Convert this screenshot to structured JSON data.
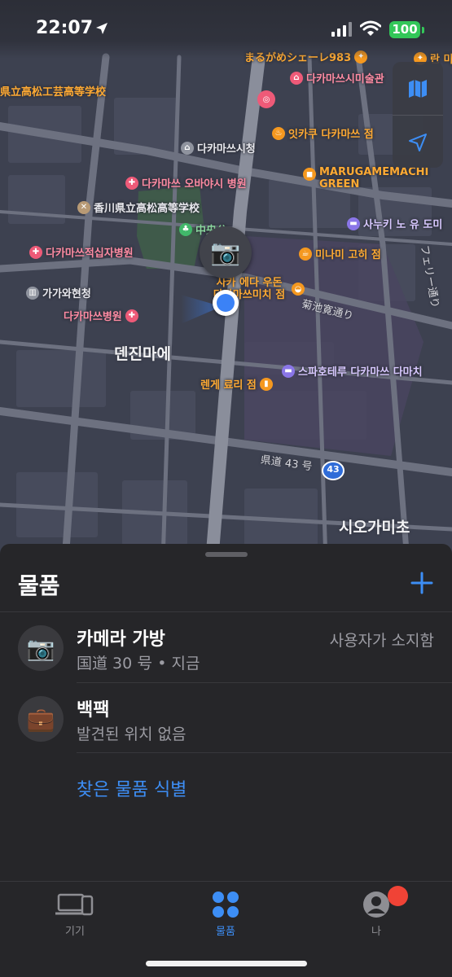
{
  "status_bar": {
    "time": "22:07",
    "battery": "100"
  },
  "map": {
    "pois": [
      {
        "id": "marugame-top",
        "label": "まるがめシェーレ983"
      },
      {
        "id": "museum",
        "label": "다카마쓰시미술관"
      },
      {
        "id": "school-left",
        "label": "県立高松工芸高等学校"
      },
      {
        "id": "city-hall",
        "label": "다카마쓰시청"
      },
      {
        "id": "restaurant-ikkaku",
        "label": "잇카쿠 다카마쓰 점"
      },
      {
        "id": "hospital-ohbayashi",
        "label": "다카마쓰 오바야시 병원"
      },
      {
        "id": "marugame-green",
        "label": "MARUGAMEMACHI GREEN"
      },
      {
        "id": "high-school",
        "label": "香川県立高松高等学校"
      },
      {
        "id": "park",
        "label": "中央公"
      },
      {
        "id": "sanuki-hotel",
        "label": "사누키 노 유 도미"
      },
      {
        "id": "red-cross",
        "label": "다카마쓰적십자병원"
      },
      {
        "id": "minami-tea",
        "label": "미나미 고히 점"
      },
      {
        "id": "kagawa-hall",
        "label": "가가와현청"
      },
      {
        "id": "udon",
        "label": "사카 에다 우돈 다카마쓰미치 점"
      },
      {
        "id": "takamatsu-hospital",
        "label": "다카마쓰병원"
      },
      {
        "id": "spa-hotel",
        "label": "스파호테루 다카마쓰 다마치"
      },
      {
        "id": "renge",
        "label": "렌게 료리 점"
      },
      {
        "id": "top-right",
        "label": "란 미"
      }
    ],
    "areas": [
      {
        "id": "denjinmae",
        "label": "덴진마에"
      },
      {
        "id": "shiogamicho",
        "label": "시오가미초"
      }
    ],
    "streets": [
      {
        "id": "kikuchi",
        "label": "菊池寛通り"
      },
      {
        "id": "route43",
        "label": "県道 43 号"
      },
      {
        "id": "ferry",
        "label": "フェリー通り"
      }
    ],
    "route_shield": "43"
  },
  "sheet": {
    "title": "물품",
    "items": [
      {
        "name": "카메라 가방",
        "subtitle": "国道 30 号 • 지금",
        "status": "사용자가 소지함",
        "icon": "camera-icon"
      },
      {
        "name": "백팩",
        "subtitle": "발견된 위치 없음",
        "status": "",
        "icon": "briefcase-icon"
      }
    ],
    "identify_link": "찾은 물품 식별"
  },
  "tabs": [
    {
      "label": "기기",
      "icon": "devices-icon",
      "active": false
    },
    {
      "label": "물품",
      "icon": "items-icon",
      "active": true
    },
    {
      "label": "나",
      "icon": "person-icon",
      "active": false
    }
  ],
  "colors": {
    "accent": "#3d8ef5",
    "badge": "#f04336",
    "battery": "#33c759"
  }
}
